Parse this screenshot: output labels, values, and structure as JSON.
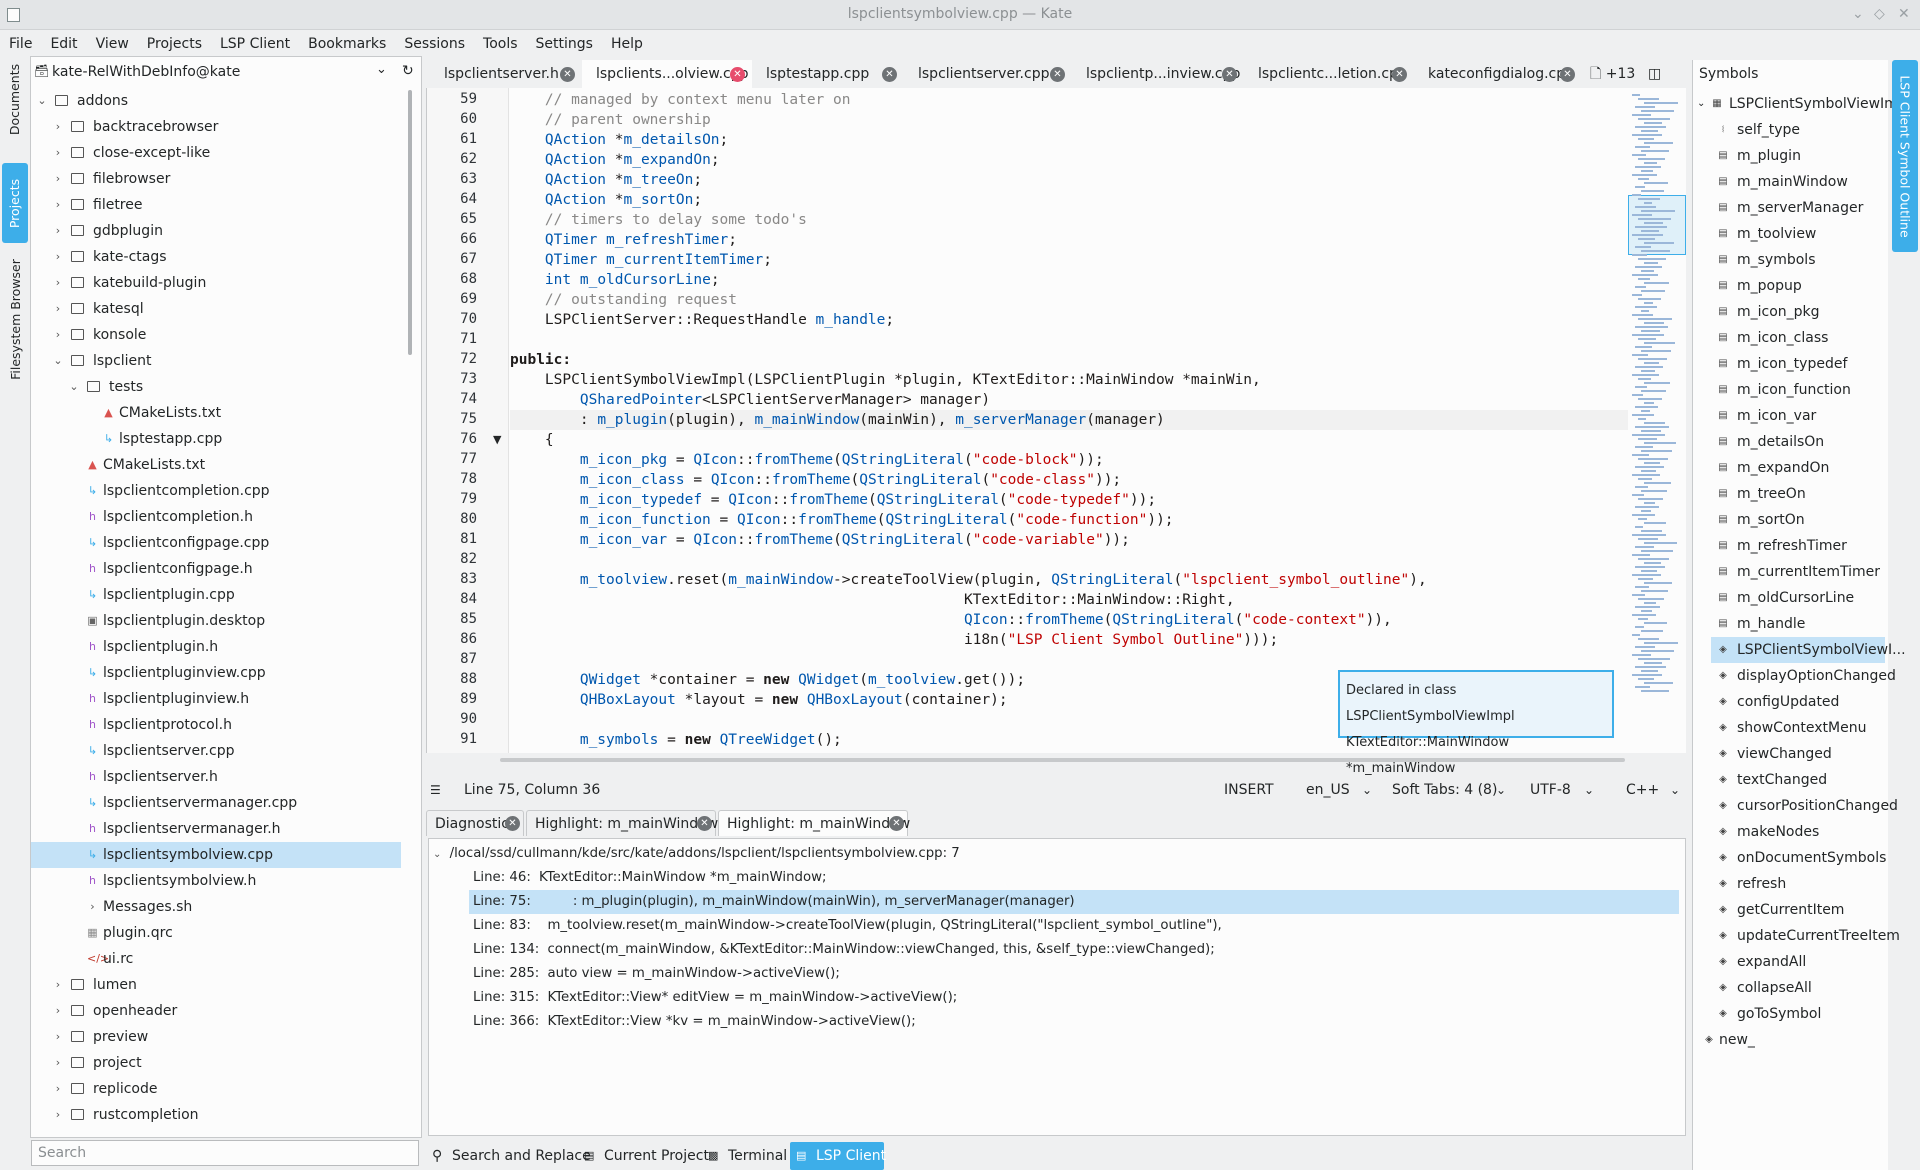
{
  "window": {
    "title": "lspclientsymbolview.cpp — Kate"
  },
  "menu": [
    "File",
    "Edit",
    "View",
    "Projects",
    "LSP Client",
    "Bookmarks",
    "Sessions",
    "Tools",
    "Settings",
    "Help"
  ],
  "left_sidebar_tabs": [
    "Documents",
    "Projects",
    "Filesystem Browser"
  ],
  "project": {
    "name": "kate-RelWithDebInfo@kate",
    "tree": [
      {
        "label": "addons",
        "depth": 0,
        "kind": "folder",
        "expanded": true
      },
      {
        "label": "backtracebrowser",
        "depth": 1,
        "kind": "folder"
      },
      {
        "label": "close-except-like",
        "depth": 1,
        "kind": "folder"
      },
      {
        "label": "filebrowser",
        "depth": 1,
        "kind": "folder"
      },
      {
        "label": "filetree",
        "depth": 1,
        "kind": "folder"
      },
      {
        "label": "gdbplugin",
        "depth": 1,
        "kind": "folder"
      },
      {
        "label": "kate-ctags",
        "depth": 1,
        "kind": "folder"
      },
      {
        "label": "katebuild-plugin",
        "depth": 1,
        "kind": "folder"
      },
      {
        "label": "katesql",
        "depth": 1,
        "kind": "folder"
      },
      {
        "label": "konsole",
        "depth": 1,
        "kind": "folder"
      },
      {
        "label": "lspclient",
        "depth": 1,
        "kind": "folder",
        "expanded": true
      },
      {
        "label": "tests",
        "depth": 2,
        "kind": "folder",
        "expanded": true
      },
      {
        "label": "CMakeLists.txt",
        "depth": 3,
        "kind": "cmake"
      },
      {
        "label": "lsptestapp.cpp",
        "depth": 3,
        "kind": "cpp"
      },
      {
        "label": "CMakeLists.txt",
        "depth": 2,
        "kind": "cmake"
      },
      {
        "label": "lspclientcompletion.cpp",
        "depth": 2,
        "kind": "cpp"
      },
      {
        "label": "lspclientcompletion.h",
        "depth": 2,
        "kind": "h"
      },
      {
        "label": "lspclientconfigpage.cpp",
        "depth": 2,
        "kind": "cpp"
      },
      {
        "label": "lspclientconfigpage.h",
        "depth": 2,
        "kind": "h"
      },
      {
        "label": "lspclientplugin.cpp",
        "depth": 2,
        "kind": "cpp"
      },
      {
        "label": "lspclientplugin.desktop",
        "depth": 2,
        "kind": "desktop"
      },
      {
        "label": "lspclientplugin.h",
        "depth": 2,
        "kind": "h"
      },
      {
        "label": "lspclientpluginview.cpp",
        "depth": 2,
        "kind": "cpp"
      },
      {
        "label": "lspclientpluginview.h",
        "depth": 2,
        "kind": "h"
      },
      {
        "label": "lspclientprotocol.h",
        "depth": 2,
        "kind": "h"
      },
      {
        "label": "lspclientserver.cpp",
        "depth": 2,
        "kind": "cpp"
      },
      {
        "label": "lspclientserver.h",
        "depth": 2,
        "kind": "h"
      },
      {
        "label": "lspclientservermanager.cpp",
        "depth": 2,
        "kind": "cpp"
      },
      {
        "label": "lspclientservermanager.h",
        "depth": 2,
        "kind": "h"
      },
      {
        "label": "lspclientsymbolview.cpp",
        "depth": 2,
        "kind": "cpp",
        "selected": true
      },
      {
        "label": "lspclientsymbolview.h",
        "depth": 2,
        "kind": "h"
      },
      {
        "label": "Messages.sh",
        "depth": 2,
        "kind": "sh"
      },
      {
        "label": "plugin.qrc",
        "depth": 2,
        "kind": "qrc"
      },
      {
        "label": "ui.rc",
        "depth": 2,
        "kind": "rc"
      },
      {
        "label": "lumen",
        "depth": 1,
        "kind": "folder"
      },
      {
        "label": "openheader",
        "depth": 1,
        "kind": "folder"
      },
      {
        "label": "preview",
        "depth": 1,
        "kind": "folder"
      },
      {
        "label": "project",
        "depth": 1,
        "kind": "folder"
      },
      {
        "label": "replicode",
        "depth": 1,
        "kind": "folder"
      },
      {
        "label": "rustcompletion",
        "depth": 1,
        "kind": "folder"
      }
    ],
    "search_placeholder": "Search"
  },
  "tabs": [
    {
      "label": "lspclientserver.h"
    },
    {
      "label": "lspclients...olview.cpp",
      "active": true,
      "modified": true
    },
    {
      "label": "lsptestapp.cpp"
    },
    {
      "label": "lspclientserver.cpp"
    },
    {
      "label": "lspclientp...inview.cpp"
    },
    {
      "label": "lspclientc...letion.cpp"
    },
    {
      "label": "kateconfigdialog.cpp"
    }
  ],
  "tabs_more": "+13",
  "editor": {
    "current_line": 75,
    "lines": [
      {
        "n": "59",
        "html": "    <span class=\"c\">// managed by context menu later on</span>"
      },
      {
        "n": "60",
        "html": "    <span class=\"c\">// parent ownership</span>"
      },
      {
        "n": "61",
        "html": "    <span class=\"t\">QAction</span> *<span class=\"m\">m_detailsOn</span>;"
      },
      {
        "n": "62",
        "html": "    <span class=\"t\">QAction</span> *<span class=\"m\">m_expandOn</span>;"
      },
      {
        "n": "63",
        "html": "    <span class=\"t\">QAction</span> *<span class=\"m\">m_treeOn</span>;"
      },
      {
        "n": "64",
        "html": "    <span class=\"t\">QAction</span> *<span class=\"m\">m_sortOn</span>;"
      },
      {
        "n": "65",
        "html": "    <span class=\"c\">// timers to delay some todo's</span>"
      },
      {
        "n": "66",
        "html": "    <span class=\"t\">QTimer</span> <span class=\"m\">m_refreshTimer</span>;"
      },
      {
        "n": "67",
        "html": "    <span class=\"t\">QTimer</span> <span class=\"m\">m_currentItemTimer</span>;"
      },
      {
        "n": "68",
        "html": "    <span class=\"t\">int</span> <span class=\"m\">m_oldCursorLine</span>;"
      },
      {
        "n": "69",
        "html": "    <span class=\"c\">// outstanding request</span>"
      },
      {
        "n": "70",
        "html": "    LSPClientServer::RequestHandle <span class=\"m\">m_handle</span>;"
      },
      {
        "n": "71",
        "html": ""
      },
      {
        "n": "72",
        "html": "<span class=\"kw\">public:</span>"
      },
      {
        "n": "73",
        "html": "    LSPClientSymbolViewImpl(LSPClientPlugin *plugin, KTextEditor::MainWindow *mainWin,"
      },
      {
        "n": "74",
        "html": "        <span class=\"t\">QSharedPointer</span>&lt;LSPClientServerManager&gt; manager)"
      },
      {
        "n": "75",
        "html": "        : <span class=\"m\">m_plugin</span>(plugin), <span class=\"m\">m_mainWindow</span>(mainWin), <span class=\"m\">m_serverManager</span>(manager)"
      },
      {
        "n": "76",
        "html": "    {"
      },
      {
        "n": "77",
        "html": "        <span class=\"m\">m_icon_pkg</span> = <span class=\"t\">QIcon</span>::<span class=\"m\">fromTheme</span>(<span class=\"t\">QStringLiteral</span>(<span class=\"s\">\"code-block\"</span>));"
      },
      {
        "n": "78",
        "html": "        <span class=\"m\">m_icon_class</span> = <span class=\"t\">QIcon</span>::<span class=\"m\">fromTheme</span>(<span class=\"t\">QStringLiteral</span>(<span class=\"s\">\"code-class\"</span>));"
      },
      {
        "n": "79",
        "html": "        <span class=\"m\">m_icon_typedef</span> = <span class=\"t\">QIcon</span>::<span class=\"m\">fromTheme</span>(<span class=\"t\">QStringLiteral</span>(<span class=\"s\">\"code-typedef\"</span>));"
      },
      {
        "n": "80",
        "html": "        <span class=\"m\">m_icon_function</span> = <span class=\"t\">QIcon</span>::<span class=\"m\">fromTheme</span>(<span class=\"t\">QStringLiteral</span>(<span class=\"s\">\"code-function\"</span>));"
      },
      {
        "n": "81",
        "html": "        <span class=\"m\">m_icon_var</span> = <span class=\"t\">QIcon</span>::<span class=\"m\">fromTheme</span>(<span class=\"t\">QStringLiteral</span>(<span class=\"s\">\"code-variable\"</span>));"
      },
      {
        "n": "82",
        "html": ""
      },
      {
        "n": "83",
        "html": "        <span class=\"m\">m_toolview</span>.reset(<span class=\"m\">m_mainWindow</span>-&gt;createToolView(plugin, <span class=\"t\">QStringLiteral</span>(<span class=\"s\">\"lspclient_symbol_outline\"</span>),"
      },
      {
        "n": "84",
        "html": "                                                    KTextEditor::MainWindow::Right,"
      },
      {
        "n": "85",
        "html": "                                                    <span class=\"t\">QIcon</span>::<span class=\"m\">fromTheme</span>(<span class=\"t\">QStringLiteral</span>(<span class=\"s\">\"code-context\"</span>)),"
      },
      {
        "n": "86",
        "html": "                                                    i18n(<span class=\"s\">\"LSP Client Symbol Outline\"</span>)));"
      },
      {
        "n": "87",
        "html": ""
      },
      {
        "n": "88",
        "html": "        <span class=\"t\">QWidget</span> *container = <span class=\"kw\">new</span> <span class=\"t\">QWidget</span>(<span class=\"m\">m_toolview</span>.get());"
      },
      {
        "n": "89",
        "html": "        <span class=\"t\">QHBoxLayout</span> *layout = <span class=\"kw\">new</span> <span class=\"t\">QHBoxLayout</span>(container);"
      },
      {
        "n": "90",
        "html": ""
      },
      {
        "n": "91",
        "html": "        <span class=\"m\">m_symbols</span> = <span class=\"kw\">new</span> <span class=\"t\">QTreeWidget</span>();"
      }
    ]
  },
  "tooltip": {
    "line1": "Declared in class LSPClientSymbolViewImpl",
    "line2": "KTextEditor::MainWindow *m_mainWindow"
  },
  "status": {
    "position": "Line 75, Column 36",
    "mode": "INSERT",
    "lang": "en_US",
    "indent": "Soft Tabs: 4 (8)",
    "encoding": "UTF-8",
    "syntax": "C++"
  },
  "bottom_tabs": [
    "Diagnostics",
    "Highlight: m_mainWindow",
    "Highlight: m_mainWindow"
  ],
  "results": {
    "file": "/local/ssd/cullmann/kde/src/kate/addons/lspclient/lspclientsymbolview.cpp: 7",
    "rows": [
      {
        "line": "Line: 46:",
        "text": "KTextEditor::MainWindow *m_mainWindow;"
      },
      {
        "line": "Line: 75:",
        "text": "        : m_plugin(plugin), m_mainWindow(mainWin), m_serverManager(manager)",
        "selected": true
      },
      {
        "line": "Line: 83:",
        "text": "  m_toolview.reset(m_mainWindow->createToolView(plugin, QStringLiteral(\"lspclient_symbol_outline\"),"
      },
      {
        "line": "Line: 134:",
        "text": "  connect(m_mainWindow, &KTextEditor::MainWindow::viewChanged, this, &self_type::viewChanged);"
      },
      {
        "line": "Line: 285:",
        "text": "  auto view = m_mainWindow->activeView();"
      },
      {
        "line": "Line: 315:",
        "text": "  KTextEditor::View* editView = m_mainWindow->activeView();"
      },
      {
        "line": "Line: 366:",
        "text": "  KTextEditor::View *kv = m_mainWindow->activeView();"
      }
    ]
  },
  "toolbar": [
    "Search and Replace",
    "Current Project",
    "Terminal",
    "LSP Client"
  ],
  "symbols": {
    "title": "Symbols",
    "root": "LSPClientSymbolViewImpl",
    "items": [
      {
        "label": "self_type",
        "kind": "typedef"
      },
      {
        "label": "m_plugin",
        "kind": "var"
      },
      {
        "label": "m_mainWindow",
        "kind": "var"
      },
      {
        "label": "m_serverManager",
        "kind": "var"
      },
      {
        "label": "m_toolview",
        "kind": "var"
      },
      {
        "label": "m_symbols",
        "kind": "var"
      },
      {
        "label": "m_popup",
        "kind": "var"
      },
      {
        "label": "m_icon_pkg",
        "kind": "var"
      },
      {
        "label": "m_icon_class",
        "kind": "var"
      },
      {
        "label": "m_icon_typedef",
        "kind": "var"
      },
      {
        "label": "m_icon_function",
        "kind": "var"
      },
      {
        "label": "m_icon_var",
        "kind": "var"
      },
      {
        "label": "m_detailsOn",
        "kind": "var"
      },
      {
        "label": "m_expandOn",
        "kind": "var"
      },
      {
        "label": "m_treeOn",
        "kind": "var"
      },
      {
        "label": "m_sortOn",
        "kind": "var"
      },
      {
        "label": "m_refreshTimer",
        "kind": "var"
      },
      {
        "label": "m_currentItemTimer",
        "kind": "var"
      },
      {
        "label": "m_oldCursorLine",
        "kind": "var"
      },
      {
        "label": "m_handle",
        "kind": "var"
      },
      {
        "label": "LSPClientSymbolViewI...",
        "kind": "func",
        "selected": true
      },
      {
        "label": "displayOptionChanged",
        "kind": "func"
      },
      {
        "label": "configUpdated",
        "kind": "func"
      },
      {
        "label": "showContextMenu",
        "kind": "func"
      },
      {
        "label": "viewChanged",
        "kind": "func"
      },
      {
        "label": "textChanged",
        "kind": "func"
      },
      {
        "label": "cursorPositionChanged",
        "kind": "func"
      },
      {
        "label": "makeNodes",
        "kind": "func"
      },
      {
        "label": "onDocumentSymbols",
        "kind": "func"
      },
      {
        "label": "refresh",
        "kind": "func"
      },
      {
        "label": "getCurrentItem",
        "kind": "func"
      },
      {
        "label": "updateCurrentTreeItem",
        "kind": "func"
      },
      {
        "label": "expandAll",
        "kind": "func"
      },
      {
        "label": "collapseAll",
        "kind": "func"
      },
      {
        "label": "goToSymbol",
        "kind": "func"
      }
    ],
    "tail": "new_"
  },
  "right_sidebar_tab": "LSP Client Symbol Outline",
  "colors": {
    "accent": "#3daee9",
    "selection": "#c4e2f7",
    "comment": "#898887",
    "type": "#0057ae",
    "string": "#bf0303"
  }
}
